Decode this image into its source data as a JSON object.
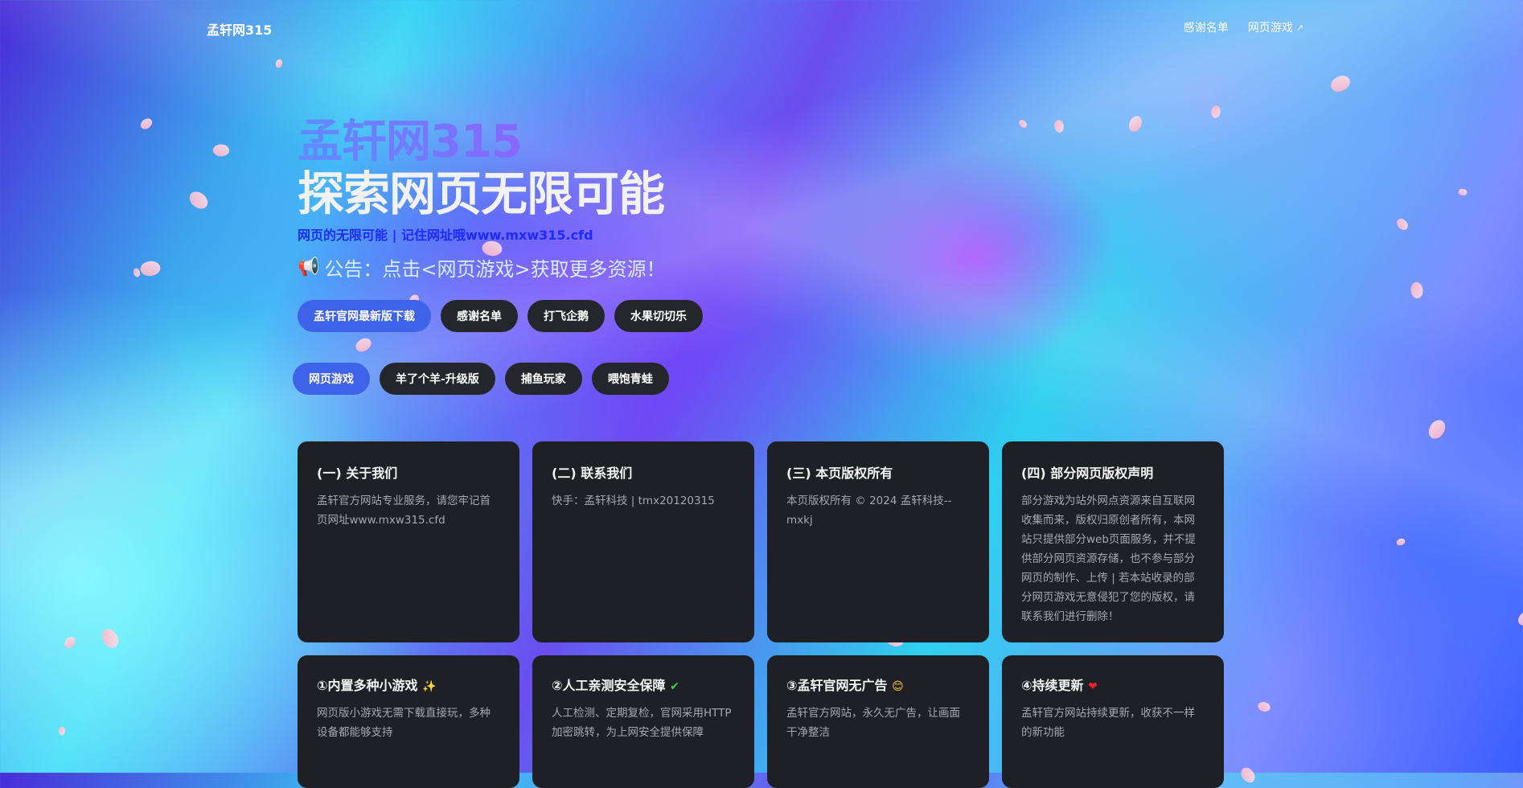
{
  "nav": {
    "brand": "孟轩网315",
    "links": [
      "感谢名单",
      "网页游戏"
    ],
    "external_icon": "↗"
  },
  "hero": {
    "title1": "孟轩网315",
    "title2": "探索网页无限可能",
    "subtitle": "网页的无限可能 | 记住网址哦www.mxw315.cfd",
    "notice_icon": "📢",
    "notice": "公告：点击<网页游戏>获取更多资源！"
  },
  "buttons_row1": [
    "孟轩官网最新版下载",
    "感谢名单",
    "打飞企鹅",
    "水果切切乐"
  ],
  "buttons_row2": [
    "网页游戏",
    "羊了个羊-升级版",
    "捕鱼玩家",
    "喂饱青蛙"
  ],
  "cards": [
    {
      "title": "(一) 关于我们",
      "body": "孟轩官方网站专业服务，请您牢记首页网址www.mxw315.cfd"
    },
    {
      "title": "(二) 联系我们",
      "body": "快手：孟轩科技 | tmx20120315"
    },
    {
      "title": "(三) 本页版权所有",
      "body": "本页版权所有 © 2024 孟轩科技--mxkj"
    },
    {
      "title": "(四) 部分网页版权声明",
      "body": "部分游戏为站外网点资源来自互联网收集而来，版权归原创者所有，本网站只提供部分web页面服务，并不提供部分网页资源存储，也不参与部分网页的制作、上传 | 若本站收录的部分网页游戏无意侵犯了您的版权，请联系我们进行删除！"
    },
    {
      "title": "①内置多种小游戏",
      "emoji": "✨",
      "body": "网页版小游戏无需下载直接玩，多种设备都能够支持"
    },
    {
      "title": "②人工亲测安全保障",
      "emoji": "✔",
      "body": "人工检测、定期复检，官网采用HTTP加密跳转，为上网安全提供保障"
    },
    {
      "title": "③孟轩官网无广告",
      "emoji": "😊",
      "body": "孟轩官方网站，永久无广告，让画面干净整洁"
    },
    {
      "title": "④持续更新",
      "emoji": "❤",
      "body": "孟轩官方网站持续更新，收获不一样的新功能"
    }
  ],
  "colors": {
    "primary_button": "#3f63e8",
    "card_bg": "#1f2026",
    "pill_bg": "#25262c",
    "subtitle": "#1e2bff"
  }
}
